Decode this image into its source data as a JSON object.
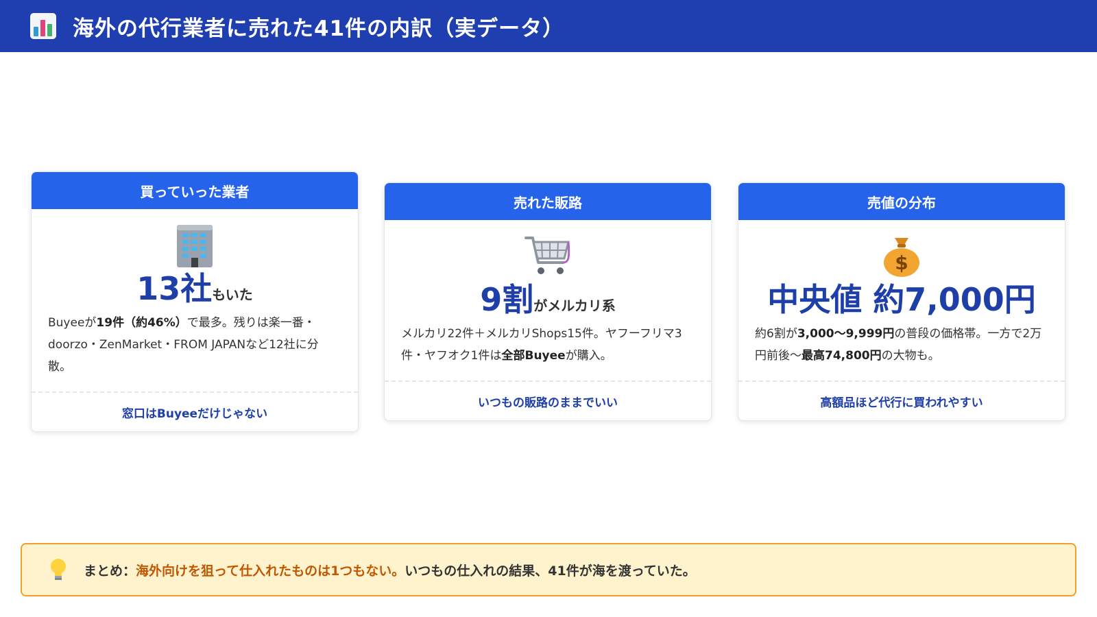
{
  "header": {
    "icon": "bar-chart-icon",
    "title": "海外の代行業者に売れた41件の内訳（実データ）"
  },
  "cards": [
    {
      "title": "買っていった業者",
      "icon": "office-building-icon",
      "big_value": "13社",
      "big_suffix": "もいた",
      "desc_1": "Buyeeが",
      "desc_2": "19件（約46%）",
      "desc_3": "で最多。残りは楽一番・doorzo・ZenMarket・FROM JAPANなど12社に分散。",
      "footer": "窓口はBuyeeだけじゃない"
    },
    {
      "title": "売れた販路",
      "icon": "shopping-cart-icon",
      "big_value": "9割",
      "big_suffix": "がメルカリ系",
      "desc_1": "メルカリ22件＋メルカリShops15件。ヤフーフリマ3件・ヤフオク1件は",
      "desc_2": "全部Buyee",
      "desc_3": "が購入。",
      "footer": "いつもの販路のままでいい"
    },
    {
      "title": "売値の分布",
      "icon": "money-bag-icon",
      "big_value": "中央値 約7,000円",
      "desc_1": "約6割が",
      "desc_2": "3,000〜9,999円",
      "desc_3": "の普段の価格帯。一方で2万円前後〜",
      "desc_4": "最高74,800円",
      "desc_5": "の大物も。",
      "footer": "高額品ほど代行に買われやすい"
    }
  ],
  "summary": {
    "icon": "light-bulb-icon",
    "label": "まとめ：",
    "highlight": "海外向けを狙って仕入れたものは1つもない。",
    "text": "いつもの仕入れの結果、41件が海を渡っていた。"
  },
  "colors": {
    "header_bg": "#1f3fb0",
    "card_head_bg": "#2563eb",
    "accent_text": "#1e3fa8",
    "summary_bg": "#fff3cd",
    "summary_border": "#f0a028",
    "summary_highlight": "#c05600"
  }
}
